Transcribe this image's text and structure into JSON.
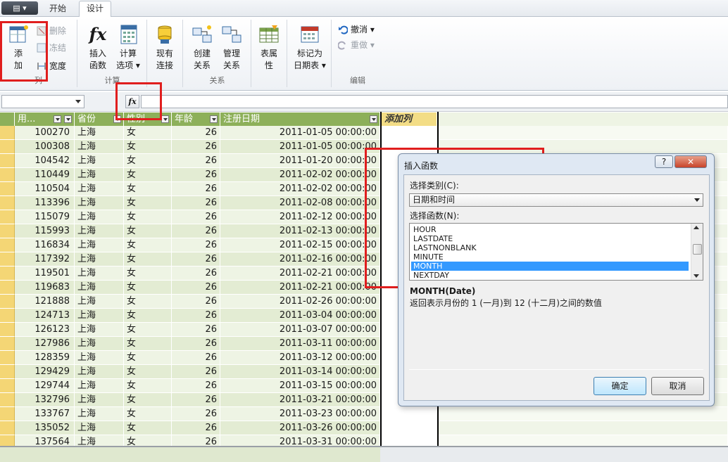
{
  "tabs": {
    "file": "▤ ▾",
    "start": "开始",
    "design": "设计"
  },
  "ribbon": {
    "add": {
      "line1": "添",
      "line2": "加"
    },
    "delete": "删除",
    "freeze": "冻结",
    "width": "宽度",
    "group_column": "列",
    "insert_func": {
      "line1": "插入",
      "line2": "函数"
    },
    "calc_opts": {
      "line1": "计算",
      "line2": "选项 ▾"
    },
    "group_calc": "计算",
    "existing_conn": {
      "line1": "现有",
      "line2": "连接"
    },
    "create_rel": {
      "line1": "创建",
      "line2": "关系"
    },
    "manage_rel": {
      "line1": "管理",
      "line2": "关系"
    },
    "group_rel": "关系",
    "table_props": {
      "line1": "表属",
      "line2": "性"
    },
    "mark_date": {
      "line1": "标记为",
      "line2": "日期表 ▾"
    },
    "undo": "撤消 ▾",
    "redo": "重做 ▾",
    "group_edit": "编辑"
  },
  "formula": {
    "fx": "fx"
  },
  "grid": {
    "headers": [
      "用...",
      "省份",
      "性别",
      "年龄",
      "注册日期",
      "添加列"
    ],
    "rows": [
      [
        "100270",
        "上海",
        "女",
        "26",
        "2011-01-05 00:00:00"
      ],
      [
        "100308",
        "上海",
        "女",
        "26",
        "2011-01-05 00:00:00"
      ],
      [
        "104542",
        "上海",
        "女",
        "26",
        "2011-01-20 00:00:00"
      ],
      [
        "110449",
        "上海",
        "女",
        "26",
        "2011-02-02 00:00:00"
      ],
      [
        "110504",
        "上海",
        "女",
        "26",
        "2011-02-02 00:00:00"
      ],
      [
        "113396",
        "上海",
        "女",
        "26",
        "2011-02-08 00:00:00"
      ],
      [
        "115079",
        "上海",
        "女",
        "26",
        "2011-02-12 00:00:00"
      ],
      [
        "115993",
        "上海",
        "女",
        "26",
        "2011-02-13 00:00:00"
      ],
      [
        "116834",
        "上海",
        "女",
        "26",
        "2011-02-15 00:00:00"
      ],
      [
        "117392",
        "上海",
        "女",
        "26",
        "2011-02-16 00:00:00"
      ],
      [
        "119501",
        "上海",
        "女",
        "26",
        "2011-02-21 00:00:00"
      ],
      [
        "119683",
        "上海",
        "女",
        "26",
        "2011-02-21 00:00:00"
      ],
      [
        "121888",
        "上海",
        "女",
        "26",
        "2011-02-26 00:00:00"
      ],
      [
        "124713",
        "上海",
        "女",
        "26",
        "2011-03-04 00:00:00"
      ],
      [
        "126123",
        "上海",
        "女",
        "26",
        "2011-03-07 00:00:00"
      ],
      [
        "127986",
        "上海",
        "女",
        "26",
        "2011-03-11 00:00:00"
      ],
      [
        "128359",
        "上海",
        "女",
        "26",
        "2011-03-12 00:00:00"
      ],
      [
        "129429",
        "上海",
        "女",
        "26",
        "2011-03-14 00:00:00"
      ],
      [
        "129744",
        "上海",
        "女",
        "26",
        "2011-03-15 00:00:00"
      ],
      [
        "132796",
        "上海",
        "女",
        "26",
        "2011-03-21 00:00:00"
      ],
      [
        "133767",
        "上海",
        "女",
        "26",
        "2011-03-23 00:00:00"
      ],
      [
        "135052",
        "上海",
        "女",
        "26",
        "2011-03-26 00:00:00"
      ],
      [
        "137564",
        "上海",
        "女",
        "26",
        "2011-03-31 00:00:00"
      ]
    ]
  },
  "dialog": {
    "title": "插入函数",
    "help": "?",
    "close": "✕",
    "category_label": "选择类别(C):",
    "category_value": "日期和时间",
    "function_label": "选择函数(N):",
    "functions": [
      "HOUR",
      "LASTDATE",
      "LASTNONBLANK",
      "MINUTE",
      "MONTH",
      "NEXTDAY"
    ],
    "selected_index": 4,
    "signature": "MONTH(Date)",
    "description": "返回表示月份的 1 (一月)到 12 (十二月)之间的数值",
    "ok": "确定",
    "cancel": "取消"
  },
  "colors": {
    "header_green": "#8db05a",
    "row_even": "#e3ecd3",
    "row_odd": "#eef4e4",
    "highlight": "#e01e1e",
    "row_selector": "#f4d675"
  }
}
